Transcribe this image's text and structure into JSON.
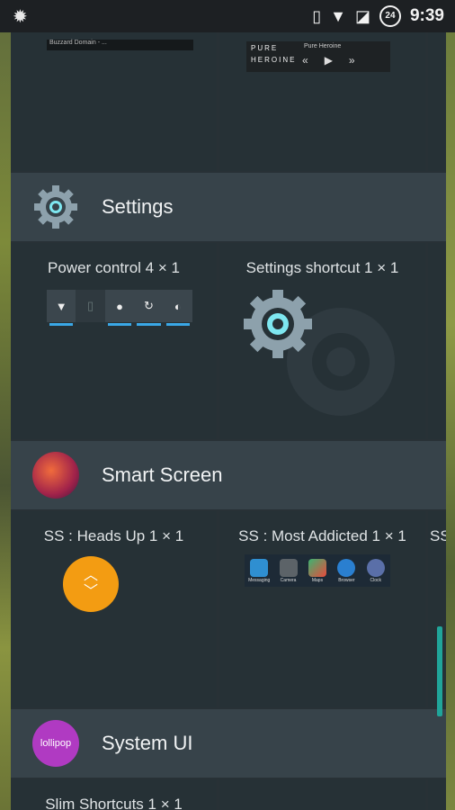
{
  "statusbar": {
    "time": "9:39",
    "badge": "24"
  },
  "top_row": {
    "email_preview": "Buzzard Domain - ...",
    "music": {
      "line1": "PURE",
      "line2": "HEROINE",
      "track": "Pure Heroine"
    }
  },
  "sections": [
    {
      "title": "Settings",
      "widgets": [
        {
          "label": "Power control  4 × 1"
        },
        {
          "label": "Settings shortcut  1 × 1"
        }
      ]
    },
    {
      "title": "Smart Screen",
      "widgets": [
        {
          "label": "SS : Heads Up  1 × 1"
        },
        {
          "label": "SS : Most Addicted  1 × 1"
        },
        {
          "label": "SS"
        }
      ],
      "apps": [
        "Messaging",
        "Camera",
        "Maps",
        "Browser",
        "Clock"
      ]
    },
    {
      "title": "System UI",
      "icon_text": "lollipop",
      "widgets": [
        {
          "label": "Slim Shortcuts  1 × 1"
        }
      ]
    }
  ],
  "colors": {
    "accent": "#3aa7e6",
    "headsup": "#f39c12",
    "scroll": "#20a59a"
  }
}
